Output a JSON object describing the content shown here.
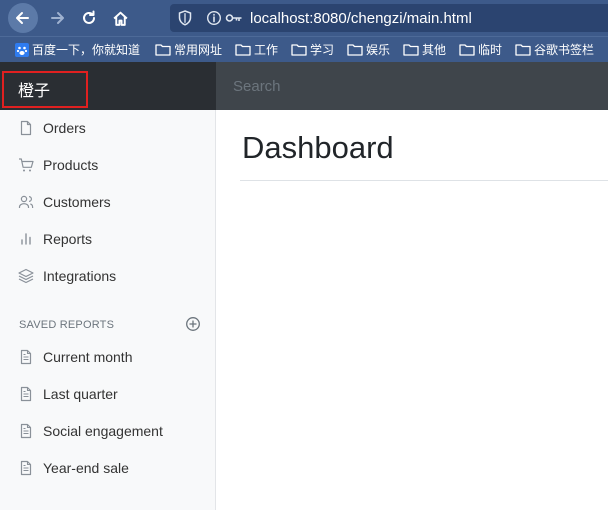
{
  "browser": {
    "url": "localhost:8080/chengzi/main.html",
    "bookmarks": [
      {
        "label": "百度一下，你就知道",
        "icon": "baidu-icon"
      },
      {
        "label": "常用网址",
        "icon": "folder-icon"
      },
      {
        "label": "工作",
        "icon": "folder-icon"
      },
      {
        "label": "学习",
        "icon": "folder-icon"
      },
      {
        "label": "娱乐",
        "icon": "folder-icon"
      },
      {
        "label": "其他",
        "icon": "folder-icon"
      },
      {
        "label": "临时",
        "icon": "folder-icon"
      },
      {
        "label": "谷歌书签栏",
        "icon": "folder-icon"
      }
    ]
  },
  "topnav": {
    "brand": "橙子",
    "search_placeholder": "Search"
  },
  "sidebar": {
    "items": [
      {
        "label": "Orders",
        "icon": "file-icon"
      },
      {
        "label": "Products",
        "icon": "shopping-cart-icon"
      },
      {
        "label": "Customers",
        "icon": "users-icon"
      },
      {
        "label": "Reports",
        "icon": "bar-chart-icon"
      },
      {
        "label": "Integrations",
        "icon": "layers-icon"
      }
    ],
    "saved_heading": "SAVED REPORTS",
    "saved_items": [
      {
        "label": "Current month",
        "icon": "file-text-icon"
      },
      {
        "label": "Last quarter",
        "icon": "file-text-icon"
      },
      {
        "label": "Social engagement",
        "icon": "file-text-icon"
      },
      {
        "label": "Year-end sale",
        "icon": "file-text-icon"
      }
    ]
  },
  "main": {
    "title": "Dashboard"
  },
  "colors": {
    "browser_chrome": "#3d5a8a",
    "topnav": "#343a40",
    "brand_bg": "#2a2e33",
    "highlight_border": "#e02020",
    "sidebar_bg": "#f8f9fa"
  }
}
